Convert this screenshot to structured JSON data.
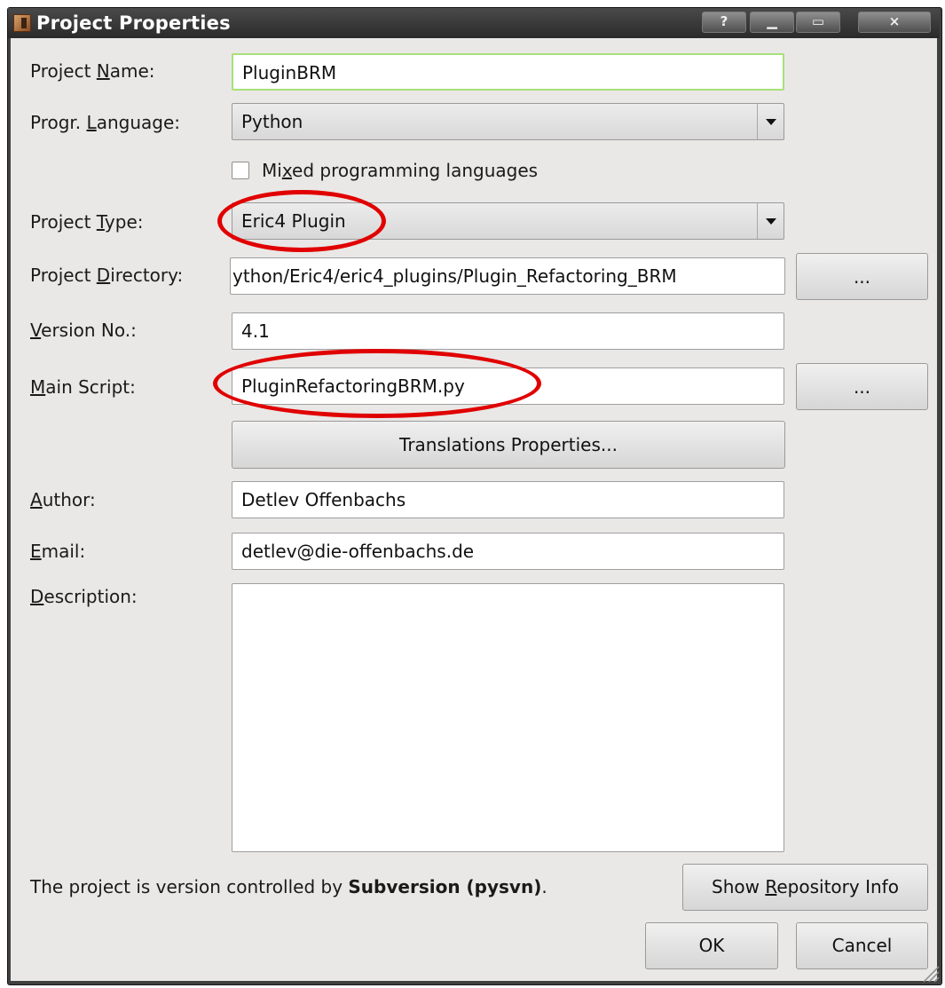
{
  "window": {
    "title": "Project Properties",
    "help_button": "?",
    "minimize_button": "▁",
    "maximize_button": "▭",
    "close_button": "×"
  },
  "form": {
    "project_name": {
      "label_pre": "Project ",
      "label_mn": "N",
      "label_post": "ame:",
      "value": "PluginBRM"
    },
    "language": {
      "label_pre": "Progr. ",
      "label_mn": "L",
      "label_post": "anguage:",
      "value": "Python"
    },
    "mixed": {
      "label_pre": "Mi",
      "label_mn": "x",
      "label_post": "ed programming languages",
      "checked": false
    },
    "project_type": {
      "label_pre": "Project ",
      "label_mn": "T",
      "label_post": "ype:",
      "value": "Eric4 Plugin"
    },
    "project_directory": {
      "label_pre": "Project ",
      "label_mn": "D",
      "label_post": "irectory:",
      "value": "ython/Eric4/eric4_plugins/Plugin_Refactoring_BRM",
      "browse_label": "..."
    },
    "version": {
      "label_pre": "",
      "label_mn": "V",
      "label_post": "ersion No.:",
      "value": "4.1"
    },
    "main_script": {
      "label_pre": "",
      "label_mn": "M",
      "label_post": "ain Script:",
      "value": "PluginRefactoringBRM.py",
      "browse_label": "..."
    },
    "translations_button": "Translations Properties...",
    "author": {
      "label_pre": "",
      "label_mn": "A",
      "label_post": "uthor:",
      "value": "Detlev Offenbachs"
    },
    "email": {
      "label_pre": "",
      "label_mn": "E",
      "label_post": "mail:",
      "value": "detlev@die-offenbachs.de"
    },
    "description": {
      "label_pre": "",
      "label_mn": "D",
      "label_post": "escription:",
      "value": ""
    }
  },
  "vcs": {
    "text_pre": "The project is version controlled by ",
    "system": "Subversion (pysvn)",
    "text_post": ".",
    "button_pre": "Show ",
    "button_mn": "R",
    "button_post": "epository Info"
  },
  "buttons": {
    "ok": "OK",
    "cancel": "Cancel"
  },
  "annotations": {
    "highlight_color": "#e00000"
  }
}
